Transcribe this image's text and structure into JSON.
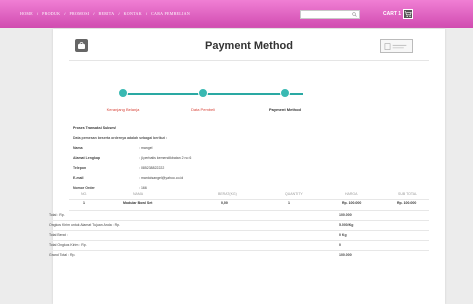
{
  "nav": {
    "items": [
      "HOME",
      "PRODUK",
      "PROMOSI",
      "BERITA",
      "KONTAK",
      "CARA PEMBELIAN"
    ],
    "cart_label": "CART 1"
  },
  "page": {
    "title": "Payment Method"
  },
  "steps": [
    {
      "label": "Keranjang Belanja"
    },
    {
      "label": "Data Pembeli"
    },
    {
      "label": "Payment Method"
    }
  ],
  "info": {
    "heading": "Proses Transaksi Sukses!",
    "subheading": "Data pemesan beserta ordernya adalah sebagai berikut :",
    "fields": [
      {
        "label": "Nama",
        "value": ": mangel"
      },
      {
        "label": "Alamat Lengkap",
        "value": ": jl.perbatis kemendikbatan 2 no 6"
      },
      {
        "label": "Telepon",
        "value": ": 085238822222"
      },
      {
        "label": "E-mail",
        "value": ": mantoisangel@yahoo.co.id"
      },
      {
        "label": "Nomor Order",
        "value": ": 166"
      }
    ]
  },
  "table": {
    "headers": [
      "NO.",
      "NAMA",
      "BERAT(KG)",
      "QUANTITY",
      "HARGA",
      "SUB TOTAL"
    ],
    "rows": [
      [
        "1",
        "Modular Bowl Set",
        "0,00",
        "1",
        "Rp. 100.000",
        "Rp. 100.000"
      ]
    ]
  },
  "summary": [
    {
      "label": "Total : Rp.",
      "value": "100.000"
    },
    {
      "label": "Ongkos Kirim untuk Alamat Tujuan Anda : Rp.",
      "value": "5.000/Kg"
    },
    {
      "label": "Total Berat :",
      "value": "0 Kg"
    },
    {
      "label": "Total Ongkos Kirim : Rp.",
      "value": "0"
    },
    {
      "label": "Grand Total : Rp.",
      "value": "100.000"
    }
  ],
  "colors": {
    "topbar": "#e062c1",
    "accent": "#39b9b2",
    "active_step_label": "#333333",
    "step_label": "#d8453a"
  }
}
